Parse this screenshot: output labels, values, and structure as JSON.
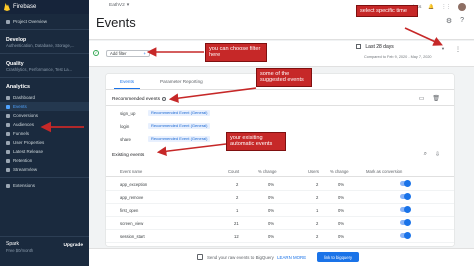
{
  "sidebar": {
    "brand": "Firebase",
    "project_overview": "Project Overview",
    "develop_title": "Develop",
    "develop_sub": "Authentication, Database, Storage,...",
    "quality_title": "Quality",
    "quality_sub": "Crashlytics, Performance, Test La...",
    "analytics_title": "Analytics",
    "items": [
      {
        "label": "Dashboard"
      },
      {
        "label": "Events"
      },
      {
        "label": "Conversions"
      },
      {
        "label": "Audiences"
      },
      {
        "label": "Funnels"
      },
      {
        "label": "User Properties"
      },
      {
        "label": "Latest Release"
      },
      {
        "label": "Retention"
      },
      {
        "label": "StreamView"
      }
    ],
    "extensions": "Extensions",
    "plan_name": "Spark",
    "plan_price": "Free $0/month",
    "upgrade": "Upgrade"
  },
  "header": {
    "project": "EathV2",
    "title": "Events",
    "docs": "Go to docs"
  },
  "filter": {
    "add_filter": "Add filter",
    "date_range": "Last 28 days",
    "compare": "Compared to Feb 9, 2020 - May 7, 2020"
  },
  "tabs": [
    {
      "label": "Events"
    },
    {
      "label": "Parameter Reporting"
    }
  ],
  "recommended": {
    "title": "Recommended events",
    "rows": [
      {
        "name": "sign_up",
        "chip": "Recommended Event (General)"
      },
      {
        "name": "login",
        "chip": "Recommended Event (General)"
      },
      {
        "name": "share",
        "chip": "Recommended Event (General)"
      }
    ]
  },
  "existing": {
    "title": "Existing events",
    "columns": [
      "Event name",
      "Count",
      "% change",
      "Users",
      "% change",
      "Mark as conversion"
    ],
    "rows": [
      {
        "name": "app_exception",
        "count": "2",
        "change": "0%",
        "users": "2",
        "uchange": "0%"
      },
      {
        "name": "app_remove",
        "count": "2",
        "change": "0%",
        "users": "2",
        "uchange": "0%"
      },
      {
        "name": "first_open",
        "count": "1",
        "change": "0%",
        "users": "1",
        "uchange": "0%"
      },
      {
        "name": "screen_view",
        "count": "21",
        "change": "0%",
        "users": "2",
        "uchange": "0%"
      },
      {
        "name": "session_start",
        "count": "12",
        "change": "0%",
        "users": "2",
        "uchange": "0%"
      }
    ]
  },
  "footer": {
    "text": "Send your raw events to BigQuery",
    "learn": "LEARN MORE",
    "button": "link to bigquery"
  },
  "annotations": {
    "time": "select specific time",
    "filter": "you can choose filter here",
    "suggested": "some of the suggested events",
    "existing": "your exisiting automatic events"
  },
  "colors": {
    "annotation": "#c62828",
    "accent": "#1a73e8",
    "sidebar": "#1a2a3e"
  }
}
